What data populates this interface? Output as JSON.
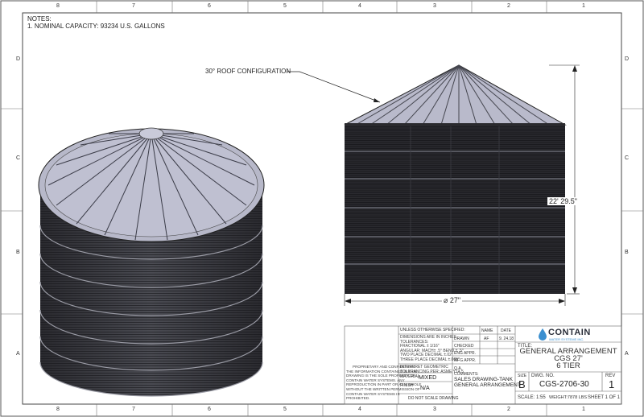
{
  "zones": {
    "top": [
      "8",
      "7",
      "6",
      "5",
      "4",
      "3",
      "2",
      "1"
    ],
    "bottom": [
      "8",
      "7",
      "6",
      "5",
      "4",
      "3",
      "2",
      "1"
    ],
    "left": [
      "D",
      "C",
      "B",
      "A"
    ],
    "right": [
      "D",
      "C",
      "B",
      "A"
    ]
  },
  "notes": {
    "heading": "NOTES:",
    "line1": "1.     NOMINAL CAPACITY: 93234 U.S. GALLONS"
  },
  "callout": "30° ROOF CONFIGURATION",
  "dims": {
    "height": "22' 29.5\"",
    "diameter": "⌀ 27\""
  },
  "title_block": {
    "unless": "UNLESS OTHERWISE SPECIFIED:",
    "tolerances": [
      "DIMENSIONS ARE IN INCHES",
      "TOLERANCES:",
      "FRACTIONAL ± 1/16\"",
      "ANGULAR: MACH± .5° BEND ± .5°",
      "TWO PLACE DECIMAL   ±.02\"",
      "THREE PLACE DECIMAL  ±.005\""
    ],
    "name_hdr": "NAME",
    "date_hdr": "DATE",
    "drawn": "DRAWN",
    "drawn_name": "AF",
    "drawn_date": "9. 24.18",
    "checked": "CHECKED",
    "eng_appr": "ENG APPR.",
    "mfg_appr": "MFG APPR.",
    "qa": "Q.A.",
    "interpret": [
      "INTERPRET GEOMETRIC",
      "TOLERANCING PER: ASME Y14.5"
    ],
    "material_lbl": "MATERIAL",
    "material": "MIXED",
    "finish_lbl": "FINISH",
    "finish": "N/A",
    "no_scale": "DO NOT SCALE DRAWING",
    "comments_lbl": "COMMENTS:",
    "comments": [
      "SALES DRAWING-TANK",
      "GENERAL ARRANGEMENT"
    ],
    "proprietary": [
      "PROPRIETARY AND CONFIDENTIAL",
      "THE INFORMATION CONTAINED IN THIS",
      "DRAWING IS THE SOLE PROPERTY OF",
      "CONTAIN WATER SYSTEMS.  ANY",
      "REPRODUCTION IN PART OR AS A WHOLE",
      "WITHOUT THE WRITTEN PERMISSION OF",
      "CONTAIN WATER SYSTEMS IS",
      "PROHIBITED."
    ],
    "logo_text": "CONTAIN",
    "logo_sub": "WATER SYSTEMS INC.",
    "title_lbl": "TITLE:",
    "title": [
      "GENERAL ARRANGEMENT",
      "CGS 27'",
      "6 TIER"
    ],
    "size_lbl": "SIZE",
    "size": "B",
    "dwg_lbl": "DWG.  NO.",
    "dwg": "CGS-2706-30",
    "rev_lbl": "REV",
    "rev": "1",
    "scale": "SCALE: 1:55",
    "weight": "WEIGHT:7878 LBS",
    "sheet": "SHEET 1 OF 1"
  }
}
